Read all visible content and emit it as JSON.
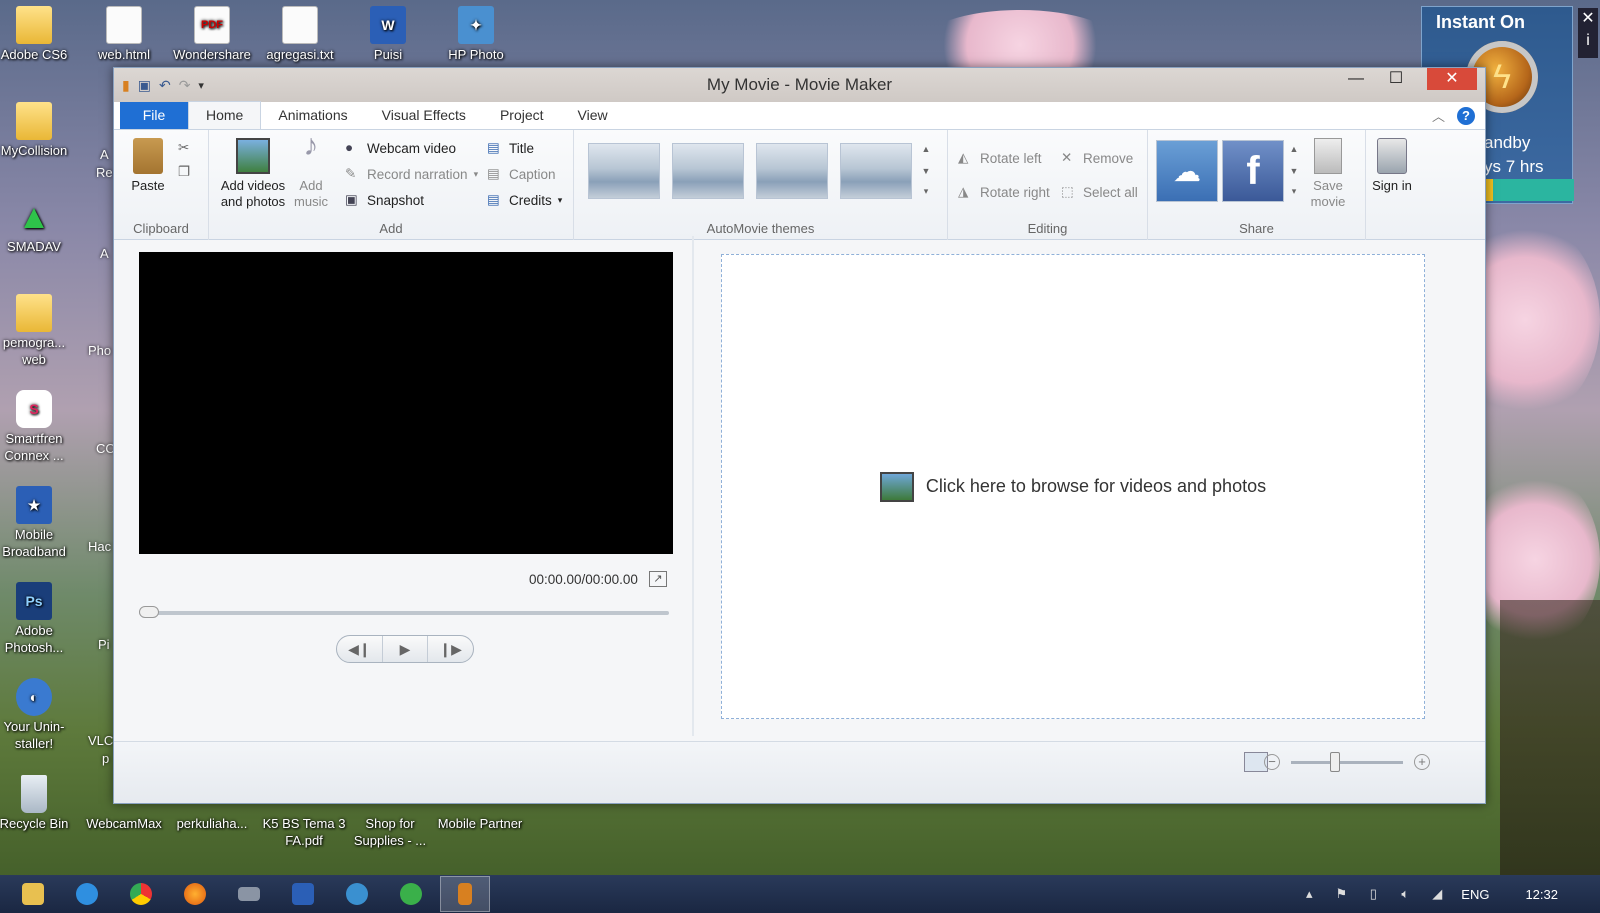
{
  "desktop": {
    "icons": [
      {
        "label": "Adobe CS6",
        "kind": "folder"
      },
      {
        "label": "MyCollision",
        "kind": "folder"
      },
      {
        "label": "SMADAV",
        "kind": "app"
      },
      {
        "label": "pemogra... web",
        "kind": "folder"
      },
      {
        "label": "Smartfren Connex ...",
        "kind": "app"
      },
      {
        "label": "Mobile Broadband",
        "kind": "app"
      },
      {
        "label": "Adobe Photosh...",
        "kind": "app"
      },
      {
        "label": "Your Unin-staller!",
        "kind": "app"
      },
      {
        "label": "Recycle Bin",
        "kind": "app"
      }
    ],
    "top_icons": [
      {
        "label": "web.html",
        "kind": "doc"
      },
      {
        "label": "Wondershare",
        "kind": "pdf"
      },
      {
        "label": "agregasi.txt",
        "kind": "doc"
      },
      {
        "label": "Puisi",
        "kind": "word"
      },
      {
        "label": "HP Photo",
        "kind": "app"
      }
    ],
    "bottom_icons": [
      {
        "label": "WebcamMax",
        "kind": "app"
      },
      {
        "label": "perkuliaha...",
        "kind": "doc"
      },
      {
        "label": "K5 BS Tema 3 FA.pdf",
        "kind": "pdf"
      },
      {
        "label": "Shop for Supplies - ...",
        "kind": "app"
      },
      {
        "label": "Mobile Partner",
        "kind": "app"
      }
    ],
    "partial_labels": [
      "A",
      "Re",
      "A",
      "Pho",
      "CC",
      "Hac",
      "Pi",
      "VLC",
      "p"
    ]
  },
  "widget": {
    "title": "Instant On",
    "line1": "andby",
    "line2": "ys 7 hrs",
    "side_close": "✕",
    "side_info": "i"
  },
  "window": {
    "title": "My Movie - Movie Maker",
    "controls": {
      "minimize": "—",
      "maximize": "☐",
      "close": "✕"
    }
  },
  "tabs": [
    "File",
    "Home",
    "Animations",
    "Visual Effects",
    "Project",
    "View"
  ],
  "active_tab": "Home",
  "ribbon": {
    "clipboard": {
      "label": "Clipboard",
      "paste": "Paste"
    },
    "add": {
      "label": "Add",
      "add_videos": "Add videos and photos",
      "add_music": "Add music",
      "webcam_video": "Webcam video",
      "record_narration": "Record narration",
      "snapshot": "Snapshot",
      "title": "Title",
      "caption": "Caption",
      "credits": "Credits"
    },
    "automovie": {
      "label": "AutoMovie themes"
    },
    "editing": {
      "label": "Editing",
      "rotate_left": "Rotate left",
      "rotate_right": "Rotate right",
      "remove": "Remove",
      "select_all": "Select all"
    },
    "share": {
      "label": "Share",
      "save_movie": "Save movie",
      "sign_in": "Sign in"
    }
  },
  "preview": {
    "timecode": "00:00.00/00:00.00"
  },
  "storyboard": {
    "prompt": "Click here to browse for videos and photos"
  },
  "taskbar": {
    "apps": [
      "file-explorer",
      "internet-explorer",
      "chrome",
      "firefox",
      "keyboard",
      "word",
      "network",
      "green-app",
      "movie-maker"
    ],
    "active_app": "movie-maker",
    "tray": {
      "language": "ENG",
      "time": "12:32"
    }
  },
  "colors": {
    "accent": "#1f6fd4",
    "close_red": "#d84a3a"
  }
}
